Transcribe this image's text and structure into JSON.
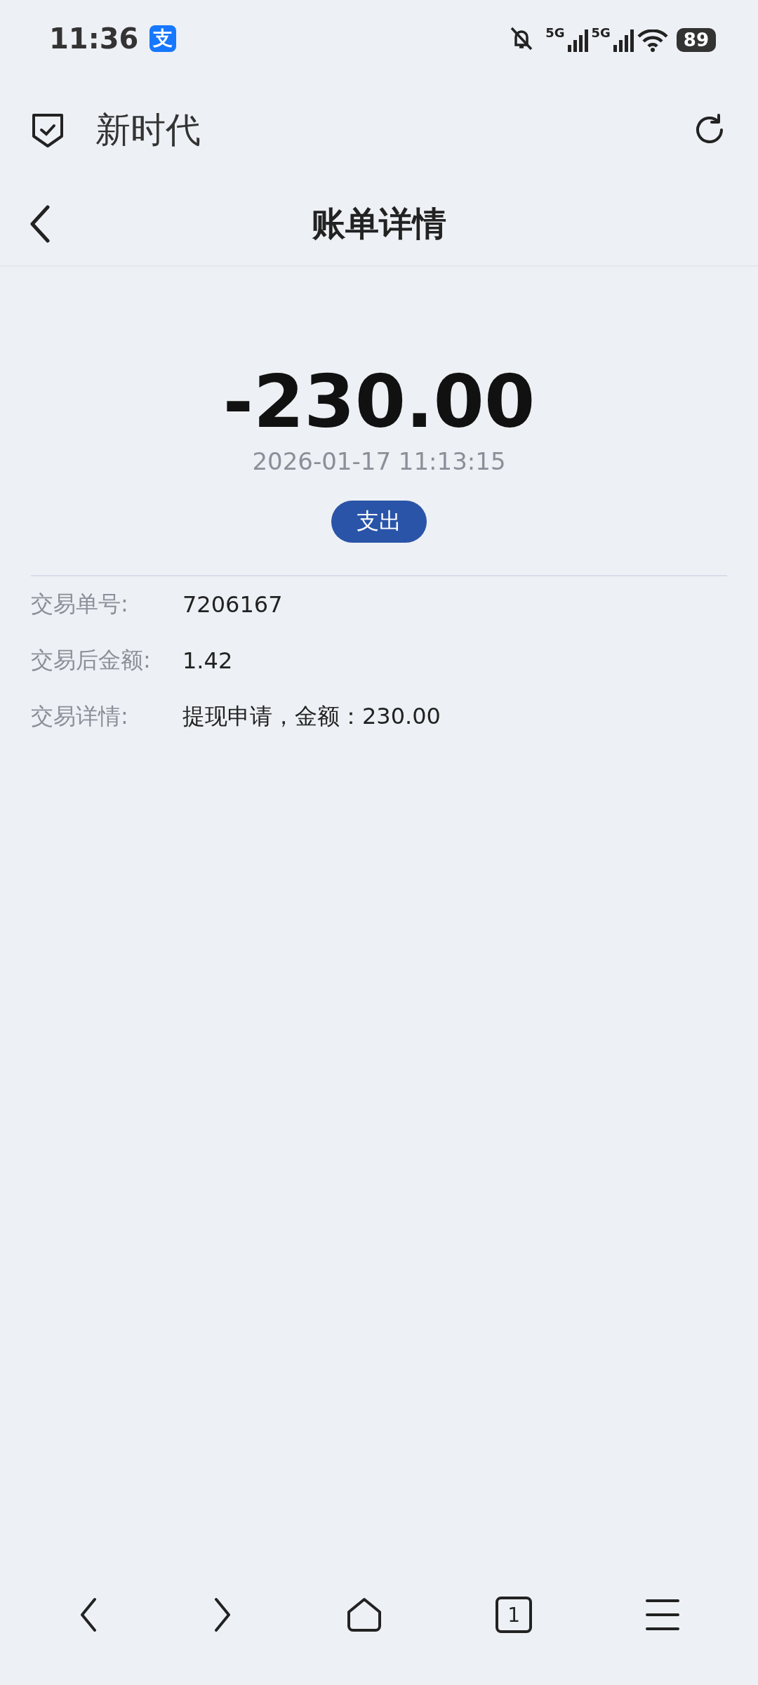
{
  "status_bar": {
    "time": "11:36",
    "app_badge": "支",
    "network_1": "5G",
    "network_2": "5G",
    "battery": "89"
  },
  "browser_bar": {
    "title": "新时代"
  },
  "header": {
    "title": "账单详情"
  },
  "bill": {
    "amount": "-230.00",
    "datetime": "2026-01-17 11:13:15",
    "type_tag": "支出",
    "rows": [
      {
        "label": "交易单号:",
        "value": "7206167"
      },
      {
        "label": "交易后金额:",
        "value": "1.42"
      },
      {
        "label": "交易详情:",
        "value": "提现申请，金额：230.00"
      }
    ]
  },
  "bottom_nav": {
    "tab_count": "1"
  }
}
